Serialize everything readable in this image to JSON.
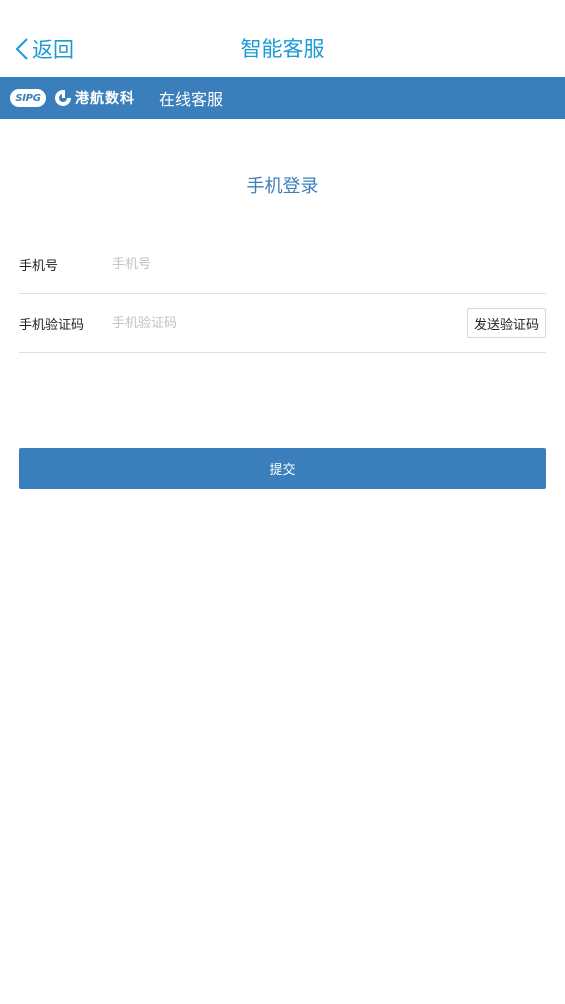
{
  "navbar": {
    "back_label": "返回",
    "title": "智能客服"
  },
  "brand": {
    "sipg": "SIPG",
    "company": "港航数科",
    "service": "在线客服"
  },
  "login": {
    "title": "手机登录",
    "phone_label": "手机号",
    "phone_placeholder": "手机号",
    "phone_value": "",
    "code_label": "手机验证码",
    "code_placeholder": "手机验证码",
    "code_value": "",
    "send_code_label": "发送验证码",
    "submit_label": "提交"
  },
  "colors": {
    "accent": "#1a9bd6",
    "brand_blue": "#3a7fbb"
  }
}
